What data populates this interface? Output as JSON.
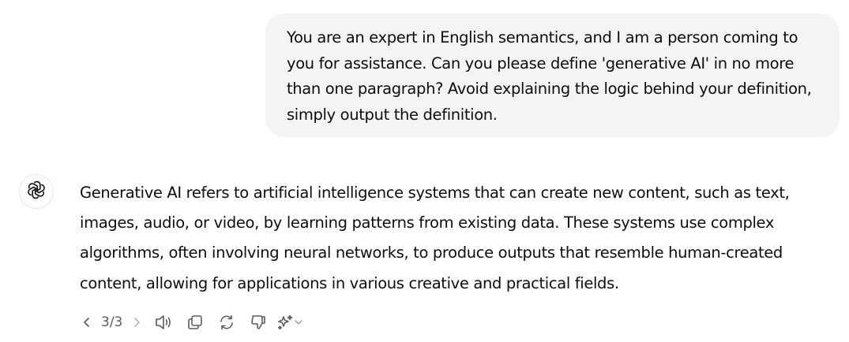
{
  "conversation": {
    "user_message": "You are an expert in English semantics, and I am a person coming to you for assistance. Can you please define 'generative AI' in no more than one paragraph? Avoid explaining the logic behind your definition, simply output the definition.",
    "assistant_message": "Generative AI refers to artificial intelligence systems that can create new content, such as text, images, audio, or video, by learning patterns from existing data. These systems use complex algorithms, often involving neural networks, to produce outputs that resemble human-created content, allowing for applications in various creative and practical fields."
  },
  "toolbar": {
    "pager": "3/3",
    "icons": {
      "previous": "chevron-left-icon",
      "next": "chevron-right-icon",
      "read_aloud": "speaker-icon",
      "copy": "copy-icon",
      "regenerate": "refresh-icon",
      "bad_response": "thumbs-down-icon",
      "model_switch": "sparkle-icon",
      "dropdown": "chevron-down-icon"
    }
  },
  "colors": {
    "user_bubble_bg": "#f4f4f4",
    "text": "#0d0d0d",
    "icon": "#5d5d5d",
    "icon_disabled": "#b4b4b4"
  }
}
